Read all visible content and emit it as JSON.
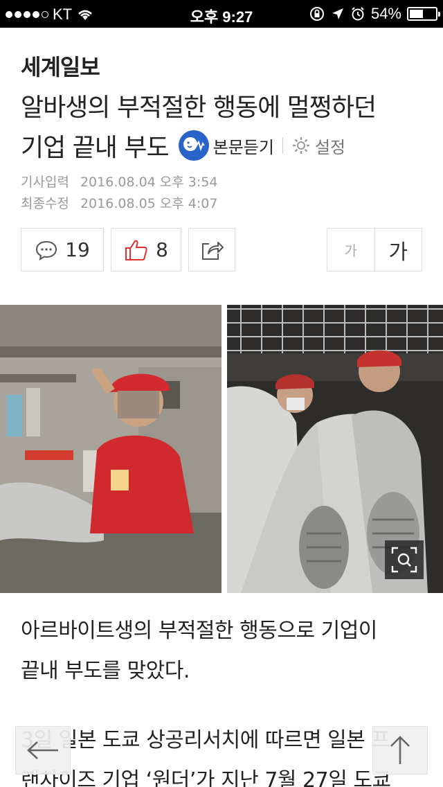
{
  "status_bar": {
    "carrier": "KT",
    "time": "오후 9:27",
    "battery_percent_label": "54%",
    "battery_level": 0.54
  },
  "article": {
    "publisher": "세계일보",
    "headline_line1": "알바생의 부적절한 행동에 멀쩡하던",
    "headline_line2": "기업 끝내 부도",
    "listen_label": "본문듣기",
    "settings_label": "설정",
    "input_label": "기사입력",
    "input_date": "2016.08.04 오후 3:54",
    "modified_label": "최종수정",
    "modified_date": "2016.08.05 오후 4:07"
  },
  "actions": {
    "comment_count": "19",
    "like_count": "8",
    "font_small": "가",
    "font_large": "가"
  },
  "body": {
    "para1_line1": "아르바이트생의 부적절한 행동으로 기업이",
    "para1_line2": "끝내 부도를 맞았다.",
    "para2_line1": "3일 일본 도쿄 상공리서치에 따르면 일본 프",
    "para2_line2": "랜차이즈 기업 ‘원더’가 지난 7월 27일 도쿄"
  },
  "colors": {
    "accent_blue": "#2a63c8",
    "like_red": "#e03030"
  },
  "icons": [
    "signal-dots-icon",
    "wifi-icon",
    "rotation-lock-icon",
    "location-icon",
    "alarm-icon",
    "battery-icon",
    "listen-icon",
    "gear-icon",
    "comment-icon",
    "thumbs-up-icon",
    "share-icon",
    "zoom-icon",
    "back-arrow-icon",
    "up-arrow-icon"
  ]
}
